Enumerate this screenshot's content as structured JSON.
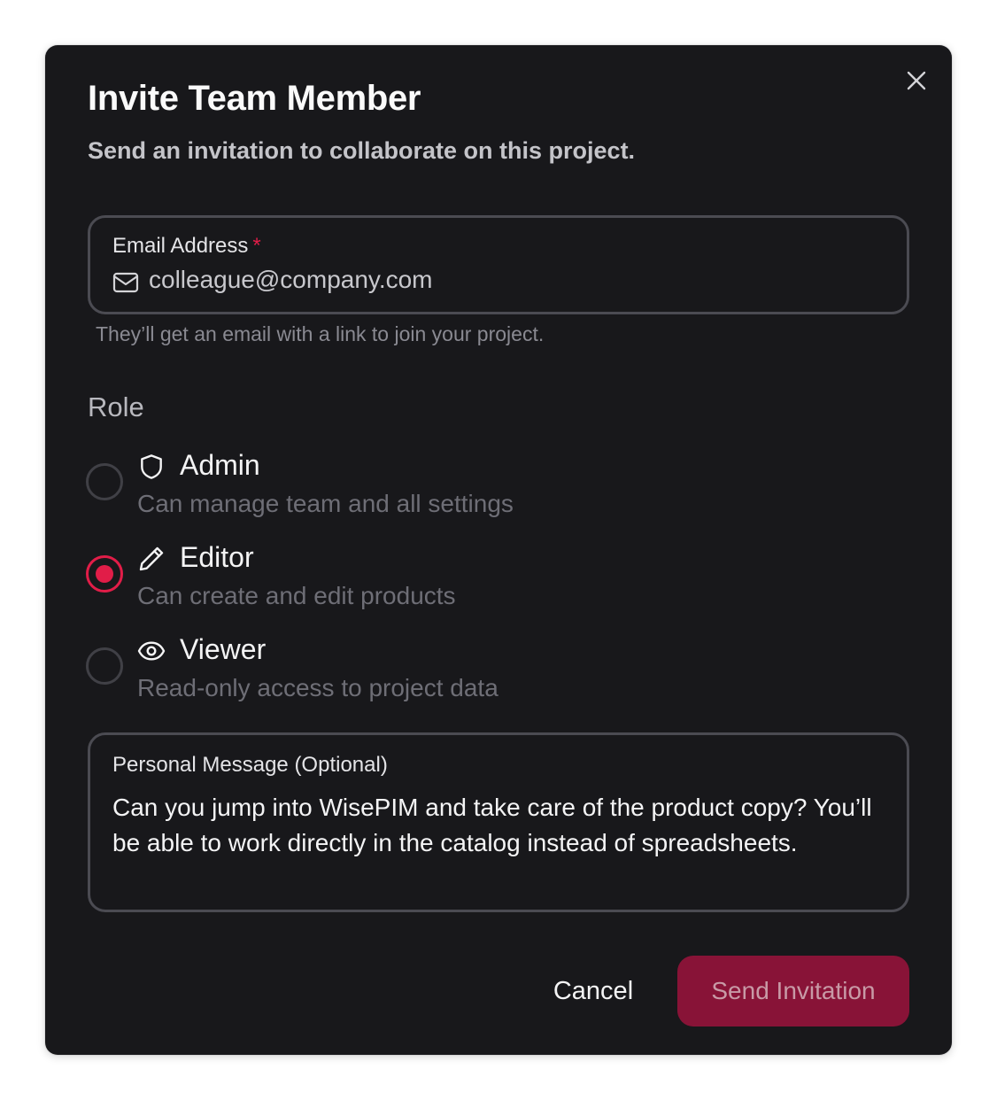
{
  "dialog": {
    "title": "Invite Team Member",
    "subtitle": "Send an invitation to collaborate on this project.",
    "close_icon": "close-icon"
  },
  "email": {
    "label": "Email Address",
    "required_marker": "*",
    "icon": "mail-icon",
    "value": "",
    "placeholder": "colleague@company.com",
    "helper": "They’ll get an email with a link to join your project."
  },
  "role": {
    "label": "Role",
    "selected": "Editor",
    "options": [
      {
        "name": "Admin",
        "description": "Can manage team and all settings",
        "icon": "shield-icon",
        "checked": false
      },
      {
        "name": "Editor",
        "description": "Can create and edit products",
        "icon": "pencil-icon",
        "checked": true
      },
      {
        "name": "Viewer",
        "description": "Read-only access to project data",
        "icon": "eye-icon",
        "checked": false
      }
    ]
  },
  "message": {
    "label": "Personal Message (Optional)",
    "value": "Can you jump into WisePIM and take care of the product copy? You’ll be able to work directly in the catalog instead of spreadsheets."
  },
  "actions": {
    "cancel_label": "Cancel",
    "send_label": "Send Invitation"
  },
  "colors": {
    "background": "#18181b",
    "accent": "#e11d48",
    "primary_button": "#881337",
    "border": "#4b4b52"
  }
}
